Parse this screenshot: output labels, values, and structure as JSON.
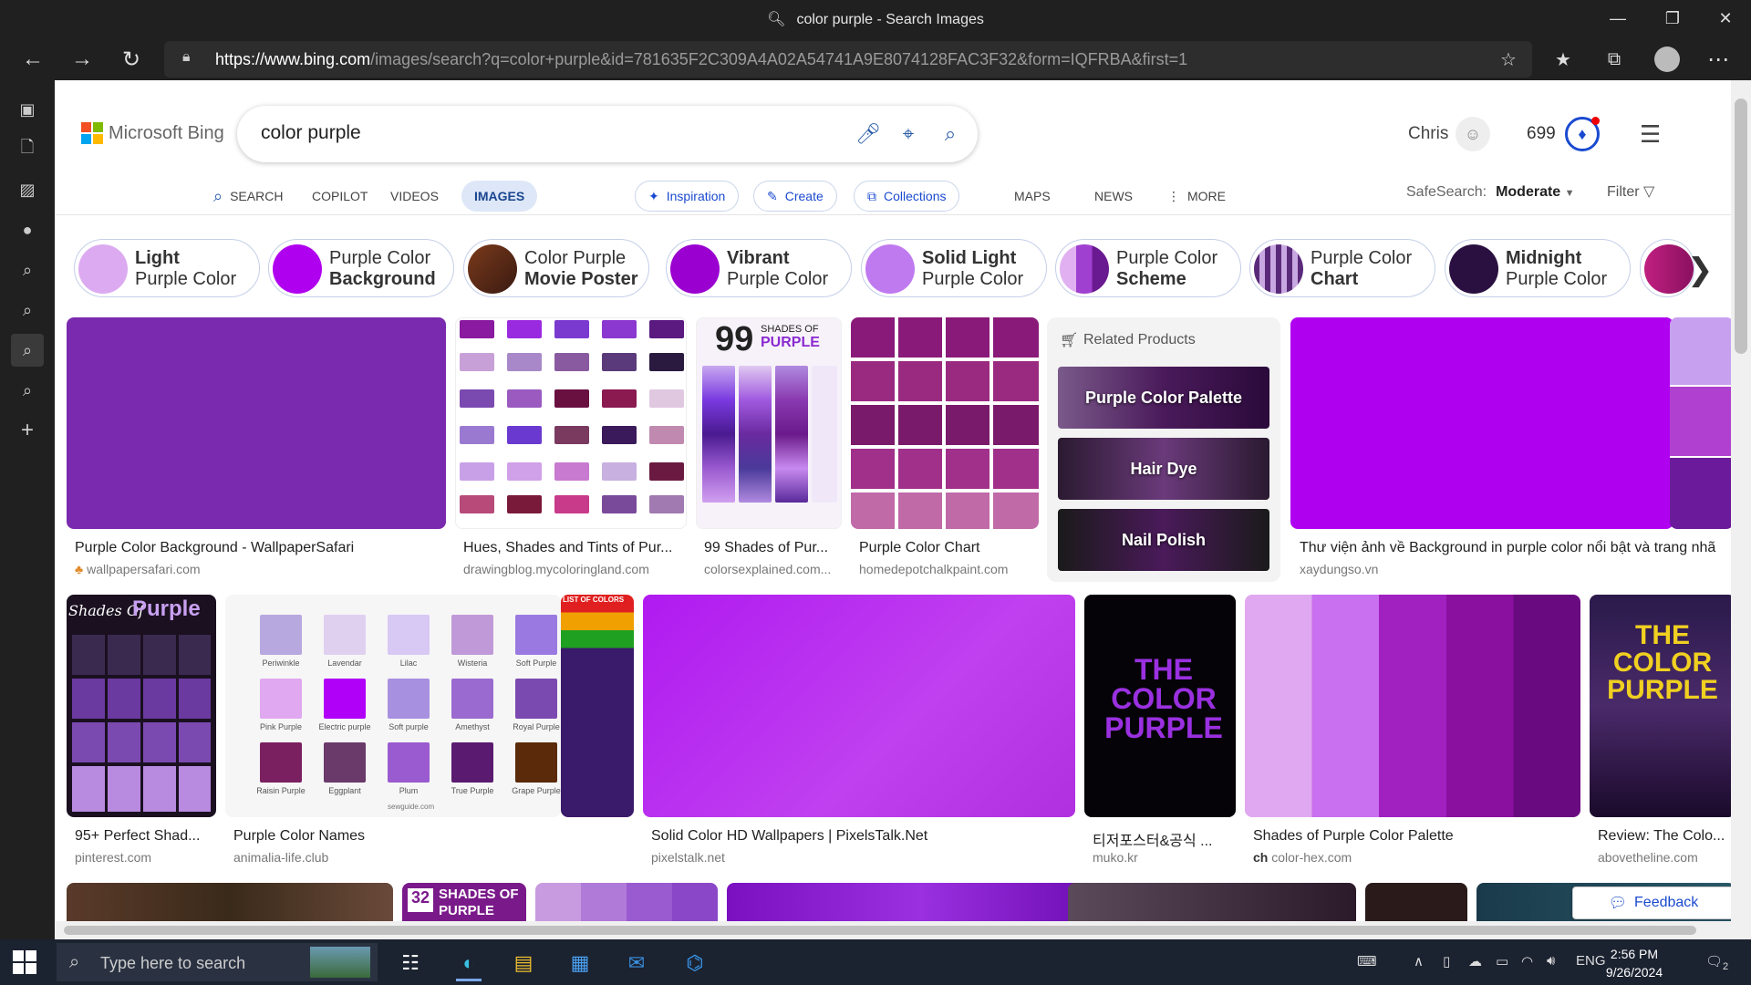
{
  "window": {
    "title": "color purple - Search Images"
  },
  "browser": {
    "url_host": "https://www.bing.com",
    "url_path": "/images/search?q=color+purple&id=781635F2C309A4A02A54741A9E8074128FAC3F32&form=IQFRBA&first=1"
  },
  "bing": {
    "logo_text": "Microsoft Bing",
    "query": "color purple",
    "user_name": "Chris",
    "points": "699"
  },
  "tabs": [
    {
      "label": "SEARCH",
      "icon": "search-icon"
    },
    {
      "label": "COPILOT"
    },
    {
      "label": "VIDEOS"
    },
    {
      "label": "IMAGES",
      "active": true
    },
    {
      "label": "Inspiration",
      "icon": "inspiration-icon"
    },
    {
      "label": "Create",
      "icon": "create-icon"
    },
    {
      "label": "Collections",
      "icon": "collections-icon"
    },
    {
      "label": "MAPS"
    },
    {
      "label": "NEWS"
    },
    {
      "label": "MORE",
      "icon": "kebab-icon"
    }
  ],
  "safesearch": {
    "label": "SafeSearch:",
    "value": "Moderate"
  },
  "filter_label": "Filter",
  "chips": [
    {
      "line1": "Light",
      "line2": "Purple Color",
      "bold": 1,
      "color": "#dcaaf0"
    },
    {
      "line1": "Purple Color",
      "line2": "Background",
      "bold": 2,
      "color": "#b000f0"
    },
    {
      "line1": "Color Purple",
      "line2": "Movie Poster",
      "bold": 2,
      "color": "#5a2a20"
    },
    {
      "line1": "Vibrant",
      "line2": "Purple Color",
      "bold": 1,
      "color": "#9a00d0"
    },
    {
      "line1": "Solid Light",
      "line2": "Purple Color",
      "bold": 1,
      "color": "#c07af0"
    },
    {
      "line1": "Purple Color",
      "line2": "Scheme",
      "bold": 2,
      "color": "#a040d0"
    },
    {
      "line1": "Purple Color",
      "line2": "Chart",
      "bold": 2,
      "color": "#7a4a9a"
    },
    {
      "line1": "Midnight",
      "line2": "Purple Color",
      "bold": 1,
      "color": "#2a1040"
    }
  ],
  "results": [
    {
      "caption": "Purple Color Background - WallpaperSafari",
      "source": "wallpapersafari.com"
    },
    {
      "caption": "Hues, Shades and Tints of Pur...",
      "source": "drawingblog.mycoloringland.com"
    },
    {
      "caption": "99 Shades of Pur...",
      "source": "colorsexplained.com..."
    },
    {
      "caption": "Purple Color Chart",
      "source": "homedepotchalkpaint.com"
    },
    {
      "caption": "Thư viện ảnh về Background in purple color nổi bật và trang nhã",
      "source": "xaydungso.vn"
    },
    {
      "caption": "95+ Perfect Shad...",
      "source": "pinterest.com"
    },
    {
      "caption": "Purple Color Names",
      "source": "animalia-life.club"
    },
    {
      "caption": "Solid Color HD Wallpapers | PixelsTalk.Net",
      "source": "pixelstalk.net"
    },
    {
      "caption": "티저포스터&공식 ...",
      "source": "muko.kr"
    },
    {
      "caption": "Shades of Purple Color Palette",
      "source": "color-hex.com"
    },
    {
      "caption": "Review: The Colo...",
      "source": "abovetheline.com"
    }
  ],
  "image_text": {
    "shades99": "99",
    "shades99_sub": "SHADES OF",
    "shades99_title": "PURPLE",
    "shades_of": "Shades Of",
    "shades_of_title": "Purple",
    "the_color": "THE COLOR PURPLE",
    "row3_badge": "32",
    "row3_title": "SHADES OF PURPLE",
    "list_of_colors": "LIST OF COLORS"
  },
  "color_names": [
    "Periwinkle",
    "Lavendar",
    "Lilac",
    "Wisteria",
    "Soft Purple",
    "Pink Purple",
    "Electric purple",
    "Soft purple",
    "Amethyst",
    "Royal Purple",
    "Raisin Purple",
    "Eggplant",
    "Plum",
    "True Purple",
    "Grape Purple"
  ],
  "color_names_credit": "sewguide.com",
  "related_products": {
    "header": "Related Products",
    "items": [
      "Purple Color Palette",
      "Hair Dye",
      "Nail Polish"
    ]
  },
  "feedback_label": "Feedback",
  "taskbar": {
    "search_placeholder": "Type here to search",
    "lang": "ENG",
    "time": "2:56 PM",
    "date": "9/26/2024",
    "notifications": "2"
  }
}
